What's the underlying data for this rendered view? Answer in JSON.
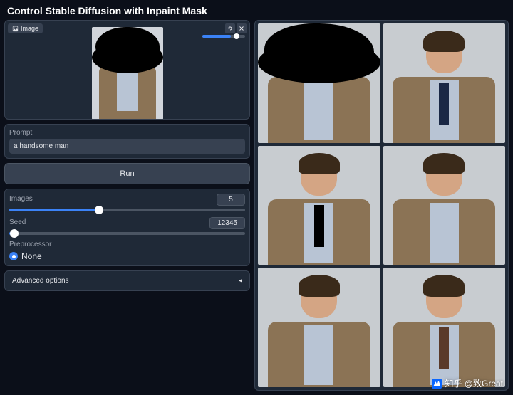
{
  "title": "Control Stable Diffusion with Inpaint Mask",
  "imageTab": "Image",
  "prompt": {
    "label": "Prompt",
    "value": "a handsome man"
  },
  "runLabel": "Run",
  "images": {
    "label": "Images",
    "value": "5",
    "percent": 38
  },
  "seed": {
    "label": "Seed",
    "value": "12345",
    "percent": 2
  },
  "preprocessor": {
    "label": "Preprocessor",
    "option": "None"
  },
  "advanced": "Advanced options",
  "watermark": "知乎 @致Great"
}
